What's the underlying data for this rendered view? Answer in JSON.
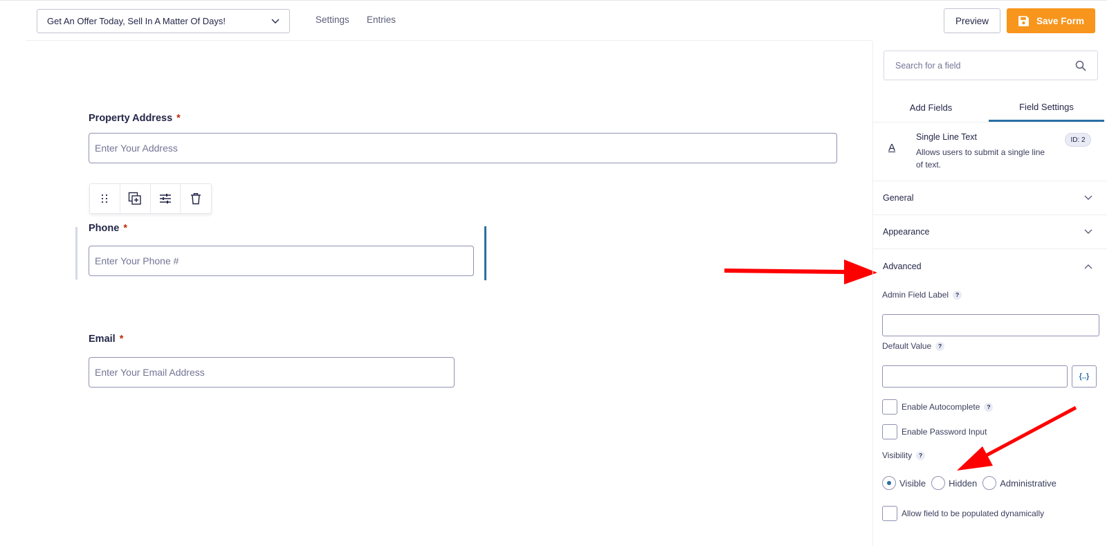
{
  "header": {
    "form_title": "Get An Offer Today, Sell In A Matter Of Days!",
    "nav": [
      "Settings",
      "Entries"
    ],
    "preview_label": "Preview",
    "save_label": "Save Form",
    "save_color": "#f7951d"
  },
  "form": {
    "fields": [
      {
        "label": "Property Address",
        "required_mark": "*",
        "placeholder": "Enter Your Address"
      },
      {
        "label": "Phone",
        "required_mark": "*",
        "placeholder": "Enter Your Phone #"
      },
      {
        "label": "Email",
        "required_mark": "*",
        "placeholder": "Enter Your Email Address"
      }
    ],
    "toolbar_icons": [
      "drag-handle-icon",
      "duplicate-icon",
      "settings-sliders-icon",
      "trash-icon"
    ]
  },
  "sidebar": {
    "search_placeholder": "Search for a field",
    "tabs": [
      "Add Fields",
      "Field Settings"
    ],
    "active_tab": "Field Settings",
    "field_info": {
      "title": "Single Line Text",
      "description": "Allows users to submit a single line of text.",
      "id_badge": "ID: 2"
    },
    "sections": [
      "General",
      "Appearance",
      "Advanced"
    ],
    "advanced": {
      "admin_label": "Admin Field Label",
      "default_value_label": "Default Value",
      "autocomplete_label": "Enable Autocomplete",
      "password_label": "Enable Password Input",
      "visibility_label": "Visibility",
      "visibility_options": [
        "Visible",
        "Hidden",
        "Administrative"
      ],
      "visibility_selected": "Visible",
      "dynamic_label": "Allow field to be populated dynamically",
      "help_mark": "?",
      "merge_tag_glyph": "{..}"
    },
    "accent_color": "#2b6fa3"
  },
  "annotations": {
    "arrow_color": "#ff0000"
  }
}
